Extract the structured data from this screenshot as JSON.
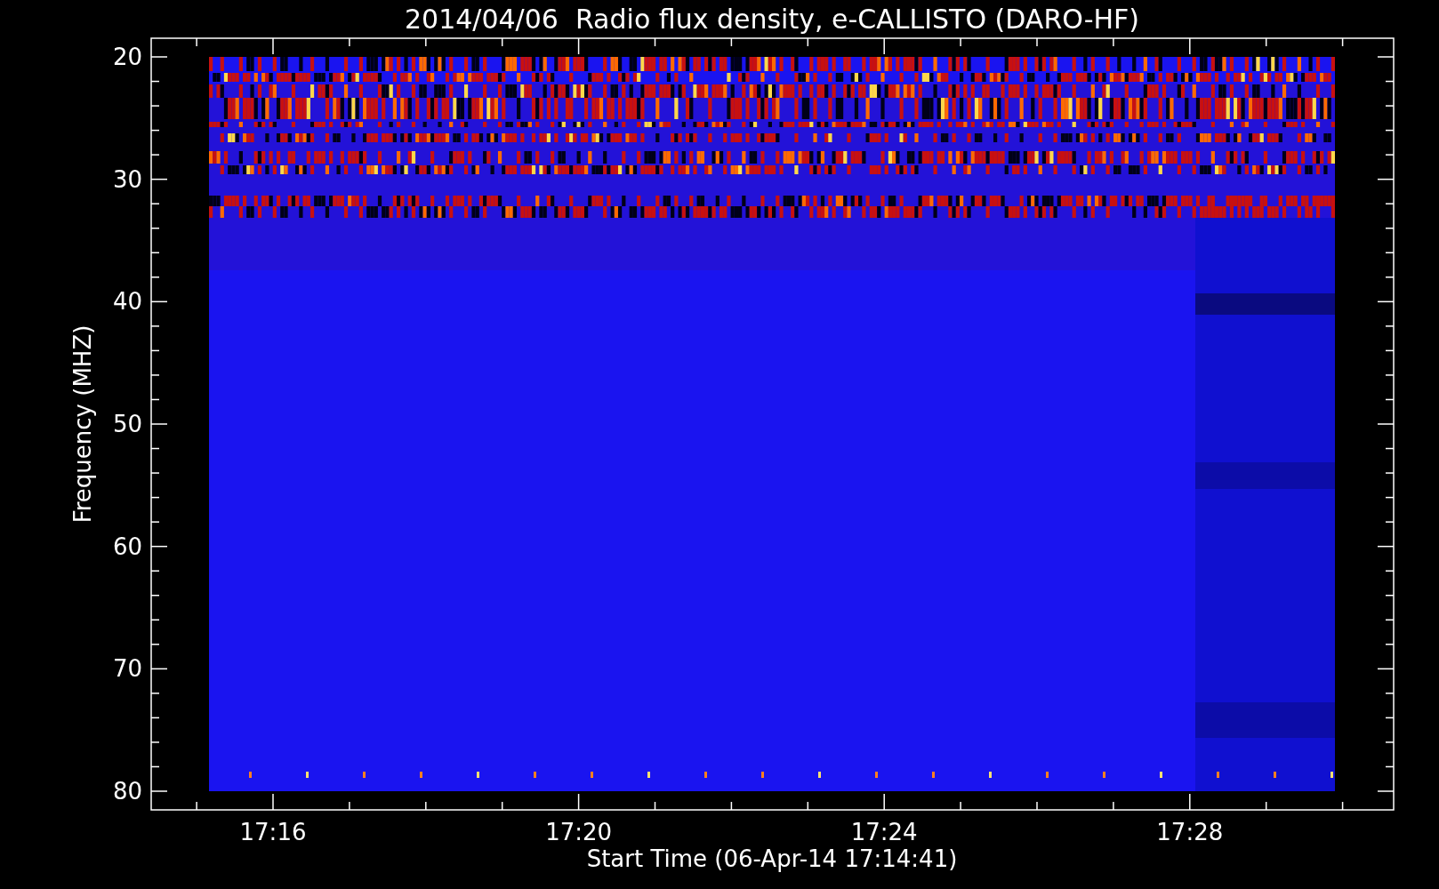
{
  "title": "2014/04/06  Radio flux density, e-CALLISTO (DARO-HF)",
  "y_axis": {
    "label": "Frequency (MHZ)",
    "ticks": [
      "20",
      "30",
      "40",
      "50",
      "60",
      "70",
      "80"
    ]
  },
  "x_axis": {
    "label": "Start Time (06-Apr-14 17:14:41)",
    "ticks": [
      "17:16",
      "17:20",
      "17:24",
      "17:28"
    ]
  }
}
